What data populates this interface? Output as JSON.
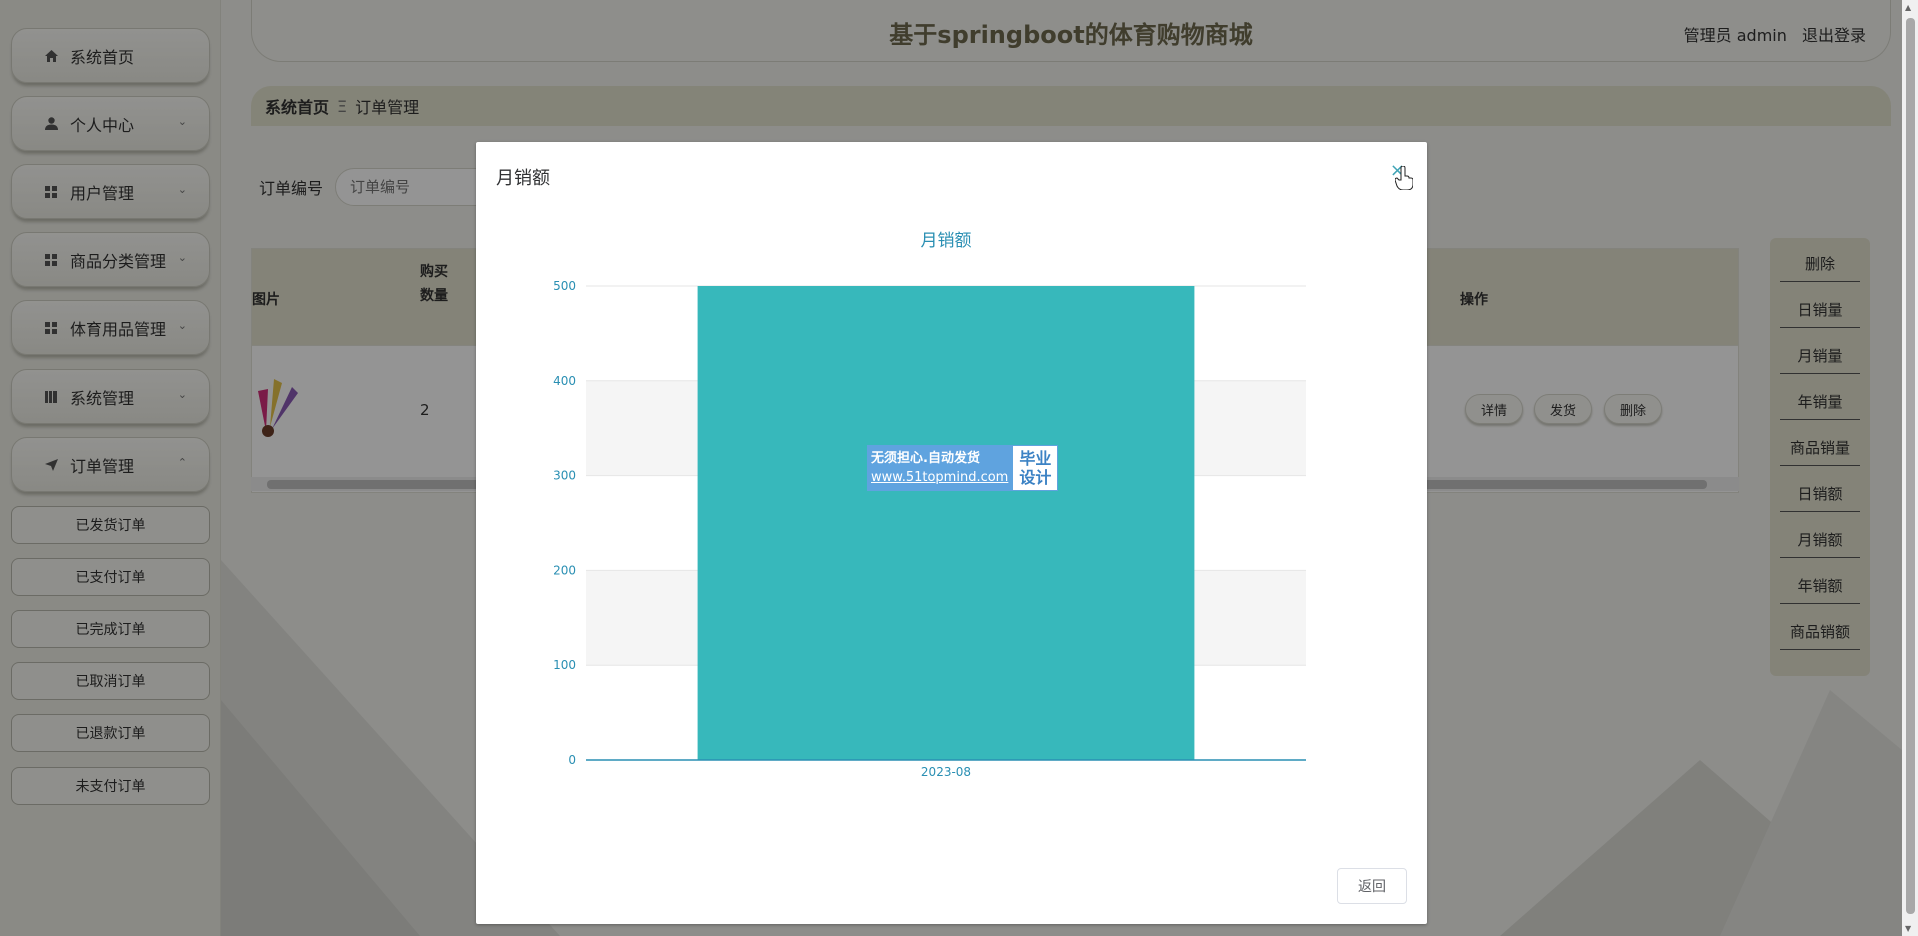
{
  "header": {
    "title": "基于springboot的体育购物商城",
    "user": "管理员 admin",
    "logout": "退出登录"
  },
  "sidebar": {
    "items": [
      {
        "label": "系统首页",
        "icon": "home-icon"
      },
      {
        "label": "个人中心",
        "icon": "user-icon"
      },
      {
        "label": "用户管理",
        "icon": "grid-icon"
      },
      {
        "label": "商品分类管理",
        "icon": "grid-icon"
      },
      {
        "label": "体育用品管理",
        "icon": "grid-icon"
      },
      {
        "label": "系统管理",
        "icon": "book-icon"
      },
      {
        "label": "订单管理",
        "icon": "send-icon"
      }
    ],
    "subitems": [
      "已发货订单",
      "已支付订单",
      "已完成订单",
      "已取消订单",
      "已退款订单",
      "未支付订单"
    ]
  },
  "breadcrumb": {
    "home": "系统首页",
    "separator": "Ξ",
    "current": "订单管理"
  },
  "search": {
    "label": "订单编号",
    "placeholder": "订单编号"
  },
  "table": {
    "headers": {
      "image": "图片",
      "qty_line1": "购买",
      "qty_line2": "数量",
      "ops": "操作"
    },
    "row": {
      "qty": "2"
    },
    "ops": [
      "详情",
      "发货",
      "删除"
    ]
  },
  "right_panel": [
    "删除",
    "日销量",
    "月销量",
    "年销量",
    "商品销量",
    "日销额",
    "月销额",
    "年销额",
    "商品销额"
  ],
  "dialog": {
    "title": "月销额",
    "close": "×",
    "back": "返回"
  },
  "watermark": {
    "line1": "无须担心.自动发货",
    "url": "www.51topmind.com",
    "right1": "毕业",
    "right2": "设计"
  },
  "chart_data": {
    "type": "bar",
    "title": "月销额",
    "categories": [
      "2023-08"
    ],
    "values": [
      500
    ],
    "ylim": [
      0,
      500
    ],
    "yticks": [
      0,
      100,
      200,
      300,
      400,
      500
    ],
    "color": "#37b8bb",
    "grid": true
  }
}
